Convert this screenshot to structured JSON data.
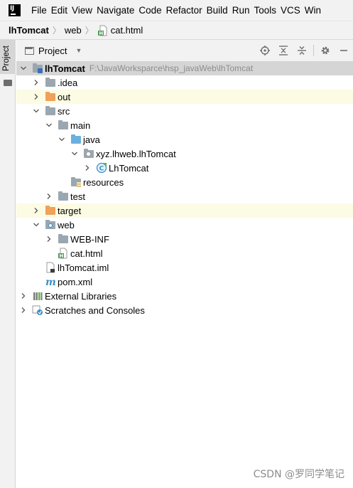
{
  "menu": {
    "logo_text": "IJ",
    "items": [
      "File",
      "Edit",
      "View",
      "Navigate",
      "Code",
      "Refactor",
      "Build",
      "Run",
      "Tools",
      "VCS",
      "Win"
    ]
  },
  "breadcrumb": {
    "project": "lhTomcat",
    "folder": "web",
    "file": "cat.html"
  },
  "sidebar": {
    "tab_label": "Project"
  },
  "tool_window": {
    "title": "Project"
  },
  "tree": {
    "root": {
      "label": "lhTomcat",
      "path": "F:\\JavaWorksparce\\hsp_javaWeb\\lhTomcat"
    },
    "idea": ".idea",
    "out": "out",
    "src": "src",
    "main": "main",
    "java": "java",
    "package": "xyz.lhweb.lhTomcat",
    "class": "LhTomcat",
    "resources": "resources",
    "test": "test",
    "target": "target",
    "web": "web",
    "webinf": "WEB-INF",
    "cathtml": "cat.html",
    "iml": "lhTomcat.iml",
    "pom": "pom.xml",
    "extlibs": "External Libraries",
    "scratches": "Scratches and Consoles"
  },
  "watermark": "CSDN @罗同学笔记",
  "colors": {
    "selection": "#d5d5d5",
    "excluded_bg": "#fcfbe3",
    "folder_grey": "#9aa7b0",
    "folder_orange": "#f0a15a",
    "folder_blue": "#6ab0de"
  }
}
